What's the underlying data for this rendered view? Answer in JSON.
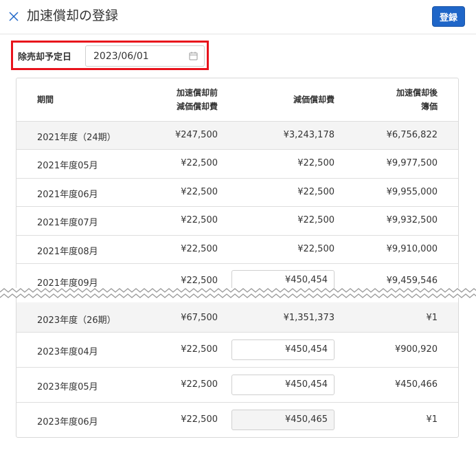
{
  "header": {
    "title": "加速償却の登録",
    "register_label": "登録"
  },
  "sale_date": {
    "label": "除売却予定日",
    "value": "2023/06/01"
  },
  "table": {
    "columns": {
      "period": "期間",
      "before_line1": "加速償却前",
      "before_line2": "減価償却費",
      "depreciation": "減価償却費",
      "after_line1": "加速償却後",
      "after_line2": "簿価"
    },
    "rows_top": [
      {
        "period": "2021年度（24期）",
        "before": "¥247,500",
        "depreciation": "¥3,243,178",
        "after": "¥6,756,822"
      },
      {
        "period": "2021年度05月",
        "before": "¥22,500",
        "depreciation": "¥22,500",
        "after": "¥9,977,500"
      },
      {
        "period": "2021年度06月",
        "before": "¥22,500",
        "depreciation": "¥22,500",
        "after": "¥9,955,000"
      },
      {
        "period": "2021年度07月",
        "before": "¥22,500",
        "depreciation": "¥22,500",
        "after": "¥9,932,500"
      },
      {
        "period": "2021年度08月",
        "before": "¥22,500",
        "depreciation": "¥22,500",
        "after": "¥9,910,000"
      },
      {
        "period": "2021年度09月",
        "before": "¥22,500",
        "depreciation": "¥450,454",
        "after": "¥9,459,546"
      }
    ],
    "rows_bottom": [
      {
        "period": "2023年度（26期）",
        "before": "¥67,500",
        "depreciation": "¥1,351,373",
        "after": "¥1"
      },
      {
        "period": "2023年度04月",
        "before": "¥22,500",
        "depreciation": "¥450,454",
        "after": "¥900,920"
      },
      {
        "period": "2023年度05月",
        "before": "¥22,500",
        "depreciation": "¥450,454",
        "after": "¥450,466"
      },
      {
        "period": "2023年度06月",
        "before": "¥22,500",
        "depreciation": "¥450,465",
        "after": "¥1"
      }
    ]
  },
  "colors": {
    "accent": "#1f66c8",
    "highlight": "#e8121b",
    "row_gray": "#f4f4f4"
  }
}
